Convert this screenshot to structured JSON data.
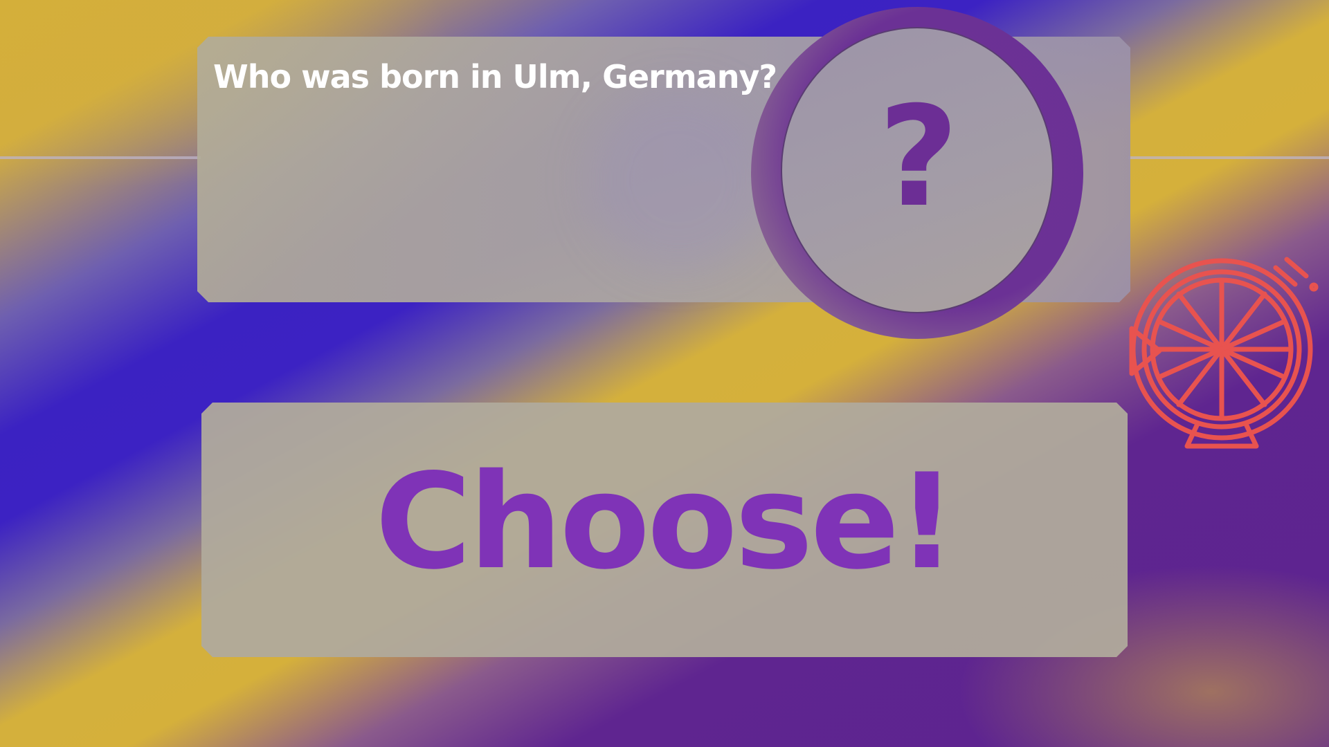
{
  "question": {
    "text": "Who was born in Ulm, Germany?"
  },
  "mystery": {
    "symbol": "?",
    "icon": "question-mark-icon"
  },
  "choose_button": {
    "label": "Choose!"
  },
  "spin_wheel": {
    "icon": "spin-wheel-icon",
    "color": "#e8534f"
  },
  "colors": {
    "accent_purple": "#7f33b7",
    "question_mark_purple": "#6c2e95",
    "background_yellow": "#d4af3a",
    "background_blue": "#3b22c2",
    "background_purple": "#5d2490"
  }
}
